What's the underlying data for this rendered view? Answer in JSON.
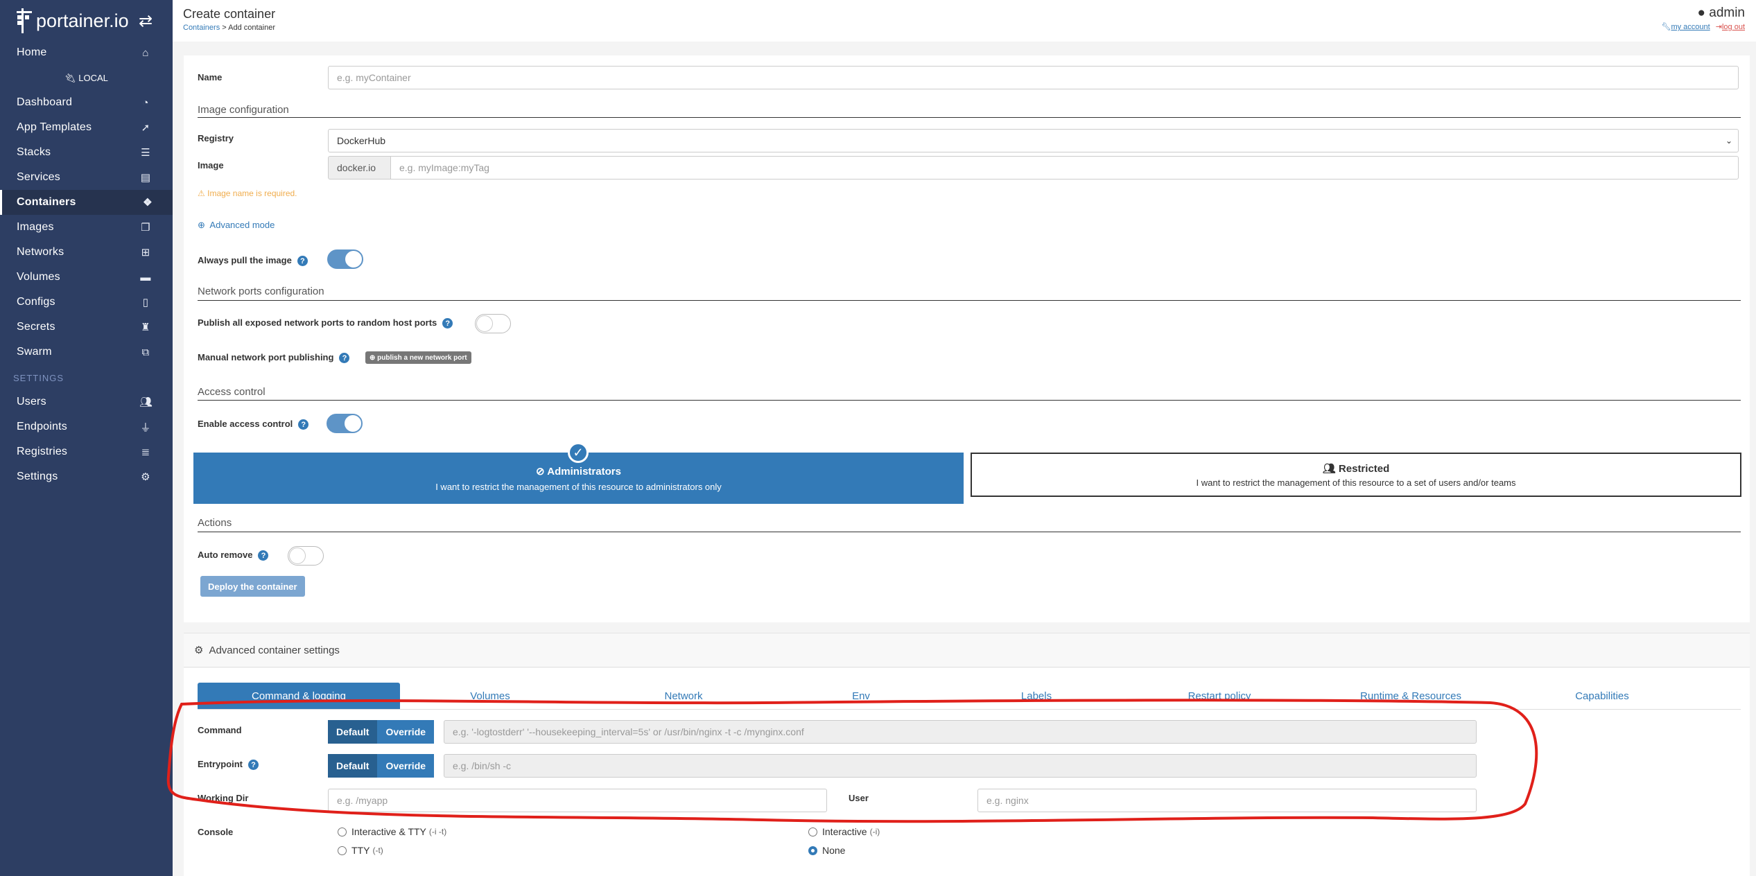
{
  "sidebar": {
    "logo_text": "portainer.io",
    "endpoint_label": "LOCAL",
    "settings_section": "SETTINGS",
    "items": [
      {
        "label": "Home",
        "icon": "home-icon"
      },
      {
        "label": "Dashboard",
        "icon": "tachometer-icon"
      },
      {
        "label": "App Templates",
        "icon": "rocket-icon"
      },
      {
        "label": "Stacks",
        "icon": "th-list-icon"
      },
      {
        "label": "Services",
        "icon": "list-alt-icon"
      },
      {
        "label": "Containers",
        "icon": "cubes-icon",
        "active": true
      },
      {
        "label": "Images",
        "icon": "clone-icon"
      },
      {
        "label": "Networks",
        "icon": "sitemap-icon"
      },
      {
        "label": "Volumes",
        "icon": "hdd-icon"
      },
      {
        "label": "Configs",
        "icon": "file-code-icon"
      },
      {
        "label": "Secrets",
        "icon": "user-secret-icon"
      },
      {
        "label": "Swarm",
        "icon": "object-group-icon"
      }
    ],
    "settings_items": [
      {
        "label": "Users",
        "icon": "users-icon"
      },
      {
        "label": "Endpoints",
        "icon": "plug-icon"
      },
      {
        "label": "Registries",
        "icon": "database-icon"
      },
      {
        "label": "Settings",
        "icon": "cogs-icon"
      }
    ]
  },
  "header": {
    "title": "Create container",
    "breadcrumb_link": "Containers",
    "breadcrumb_rest": "> Add container",
    "user": "admin",
    "my_account": "my account",
    "log_out": "log out"
  },
  "form": {
    "name_label": "Name",
    "name_placeholder": "e.g. myContainer",
    "image_config_title": "Image configuration",
    "registry_label": "Registry",
    "registry_value": "DockerHub",
    "image_label": "Image",
    "image_prefix": "docker.io",
    "image_placeholder": "e.g. myImage:myTag",
    "image_warning": "Image name is required.",
    "advanced_mode": "Advanced mode",
    "always_pull_label": "Always pull the image",
    "always_pull_on": true,
    "network_ports_title": "Network ports configuration",
    "publish_all_label": "Publish all exposed network ports to random host ports",
    "publish_all_on": false,
    "manual_publish_label": "Manual network port publishing",
    "publish_new_port_btn": "publish a new network port",
    "access_control_title": "Access control",
    "enable_access_label": "Enable access control",
    "enable_access_on": true,
    "admin_title": "Administrators",
    "admin_desc": "I want to restrict the management of this resource to administrators only",
    "restricted_title": "Restricted",
    "restricted_desc": "I want to restrict the management of this resource to a set of users and/or teams",
    "actions_title": "Actions",
    "auto_remove_label": "Auto remove",
    "auto_remove_on": false,
    "deploy_btn": "Deploy the container"
  },
  "advanced": {
    "header": "Advanced container settings",
    "tabs": [
      "Command & logging",
      "Volumes",
      "Network",
      "Env",
      "Labels",
      "Restart policy",
      "Runtime & Resources",
      "Capabilities"
    ],
    "active_tab": "Command & logging",
    "command_label": "Command",
    "command_placeholder": "e.g. '-logtostderr' '--housekeeping_interval=5s' or /usr/bin/nginx -t -c /mynginx.conf",
    "entrypoint_label": "Entrypoint",
    "entrypoint_placeholder": "e.g. /bin/sh -c",
    "default_btn": "Default",
    "override_btn": "Override",
    "working_dir_label": "Working Dir",
    "working_dir_placeholder": "e.g. /myapp",
    "user_label": "User",
    "user_placeholder": "e.g. nginx",
    "console_label": "Console",
    "console_options": [
      {
        "label": "Interactive & TTY",
        "flag": "(-i -t)",
        "selected": false
      },
      {
        "label": "Interactive",
        "flag": "(-i)",
        "selected": false
      },
      {
        "label": "TTY",
        "flag": "(-t)",
        "selected": false
      },
      {
        "label": "None",
        "flag": "",
        "selected": true
      }
    ]
  },
  "colors": {
    "sidebar": "#2d3e63",
    "accent": "#337ab7",
    "annotation": "#e0201a"
  }
}
